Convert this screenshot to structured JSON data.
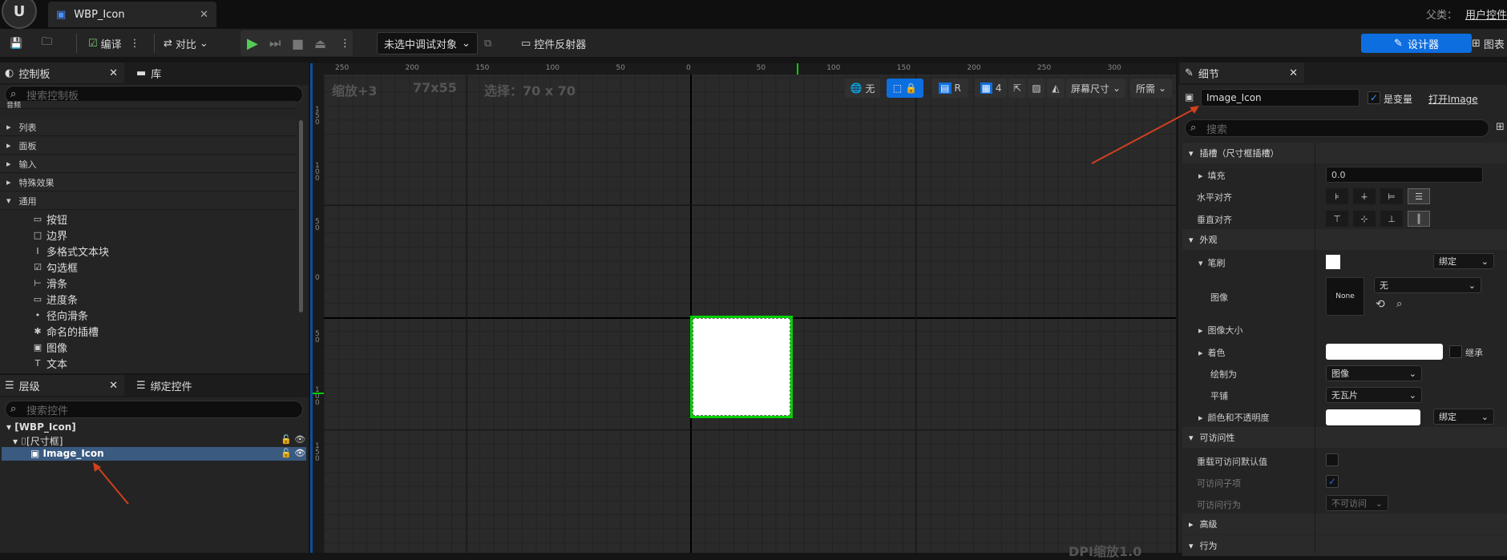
{
  "title_bar": {
    "tab_title": "WBP_Icon",
    "parent_label": "父类：",
    "parent_value": "用户控件"
  },
  "toolbar": {
    "compile": "编译",
    "diff": "对比",
    "debug_select": "未选中调试对象",
    "widget_reflector": "控件反射器",
    "designer": "设计器",
    "graph": "图表"
  },
  "palette": {
    "tab_palette": "控制板",
    "tab_library": "库",
    "search_placeholder": "搜索控制板",
    "categories": [
      "音频",
      "列表",
      "面板",
      "输入",
      "特殊效果",
      "通用"
    ],
    "items": [
      {
        "label": "按钮",
        "icon": "▭"
      },
      {
        "label": "边界",
        "icon": "□"
      },
      {
        "label": "多格式文本块",
        "icon": "Ⅰ"
      },
      {
        "label": "勾选框",
        "icon": "☑"
      },
      {
        "label": "滑条",
        "icon": "⊢"
      },
      {
        "label": "进度条",
        "icon": "▭"
      },
      {
        "label": "径向滑条",
        "icon": "•"
      },
      {
        "label": "命名的插槽",
        "icon": "✱"
      },
      {
        "label": "图像",
        "icon": "▣"
      },
      {
        "label": "文本",
        "icon": "T"
      }
    ]
  },
  "hierarchy": {
    "tab_hierarchy": "层级",
    "tab_bind": "绑定控件",
    "search_placeholder": "搜索控件",
    "root": "[WBP_Icon]",
    "size_box": "[尺寸框]",
    "image": "Image_Icon"
  },
  "viewport": {
    "zoom": "缩放+3",
    "size": "77x55",
    "selection": "选择：70 x 70",
    "none_btn": "无",
    "r_btn": "R",
    "grid_num": "4",
    "screen_size": "屏幕尺寸",
    "desired": "所需",
    "dpi": "DPI缩放1.0",
    "ruler_h": [
      "250",
      "200",
      "150",
      "100",
      "50",
      "0",
      "50",
      "100",
      "150",
      "200",
      "250",
      "300"
    ],
    "ruler_v": [
      "1 5 0",
      "1 0 0",
      "5 0",
      "0",
      "5 0",
      "1 0 0",
      "1 5 0"
    ]
  },
  "details": {
    "tab": "细节",
    "name_value": "Image_Icon",
    "is_variable": "是变量",
    "open_image": "打开Image",
    "search_placeholder": "搜索",
    "slot_section": "插槽（尺寸框插槽）",
    "padding_label": "填充",
    "padding_value": "0.0",
    "h_align": "水平对齐",
    "v_align": "垂直对齐",
    "appearance_section": "外观",
    "brush_label": "笔刷",
    "bind_label": "绑定",
    "image_label": "图像",
    "image_none": "None",
    "image_dropdown": "无",
    "image_size": "图像大小",
    "tint_label": "着色",
    "inherit": "继承",
    "draw_as_label": "绘制为",
    "draw_as_value": "图像",
    "tiling_label": "平铺",
    "tiling_value": "无瓦片",
    "color_opacity": "颜色和不透明度",
    "bind_label2": "绑定",
    "accessibility_section": "可访问性",
    "override_access": "重载可访问默认值",
    "access_children": "可访问子项",
    "access_behavior": "可访问行为",
    "access_behavior_value": "不可访问",
    "advanced_section": "高级",
    "behavior_section": "行为"
  },
  "colors": {
    "accent": "#0d6ee0",
    "selection_green": "#00d000",
    "arrow_red": "#d04020"
  }
}
